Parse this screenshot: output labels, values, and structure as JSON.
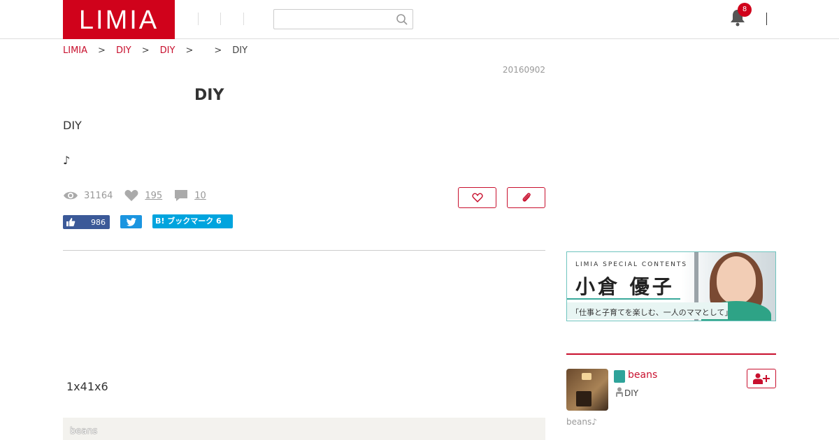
{
  "header": {
    "logo": "LIMIA",
    "notification_count": "8"
  },
  "breadcrumb": {
    "items": [
      "LIMIA",
      "DIY",
      "DIY",
      "",
      "DIY"
    ],
    "separator": ">"
  },
  "article": {
    "date": "20160902",
    "title": "DIY",
    "lead": "DIY",
    "lead2": "♪",
    "views": "31164",
    "likes": "195",
    "comments": "10",
    "size_text": "1x41x6",
    "beans_label": "beans"
  },
  "share": {
    "facebook_count": "986",
    "hatena_label": "B! ブックマーク 6"
  },
  "sidebar": {
    "banner": {
      "small": "LIMIA SPECIAL CONTENTS",
      "name": "小倉 優子",
      "tagline": "「仕事と子育てを楽しむ、一人のママとして」"
    },
    "author": {
      "name": "beans",
      "role": "DIY",
      "bio": "beans♪"
    }
  },
  "colors": {
    "brand": "#d0021b",
    "link": "#c8102e",
    "facebook": "#3b5998",
    "twitter": "#1b95e0",
    "hatena": "#00a4de",
    "accent_teal": "#2ea39a"
  }
}
